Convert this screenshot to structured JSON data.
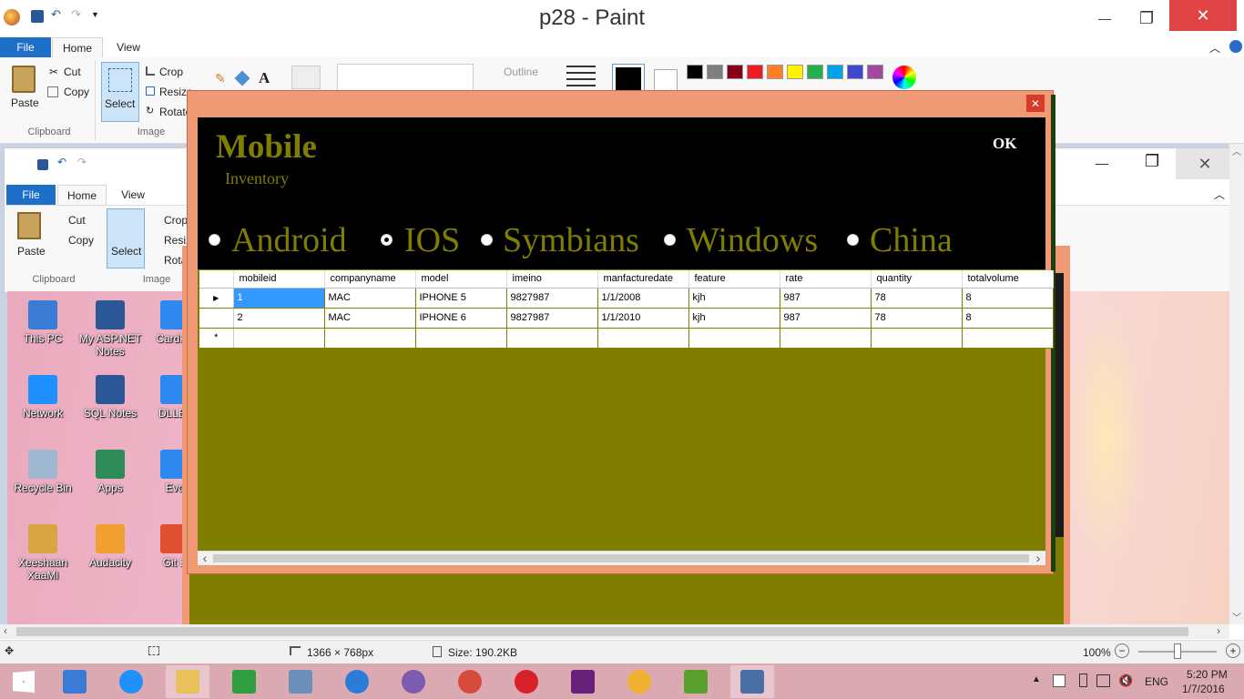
{
  "window": {
    "title": "p28 - Paint",
    "minimize": "—",
    "maximize": "❐",
    "close": "✕"
  },
  "ribbon": {
    "file_tab": "File",
    "home_tab": "Home",
    "view_tab": "View",
    "paste": "Paste",
    "cut": "Cut",
    "copy": "Copy",
    "clipboard_group": "Clipboard",
    "select": "Select",
    "crop": "Crop",
    "resize": "Resize",
    "rotate": "Rotate",
    "image_group": "Image",
    "outline": "Outline",
    "colors": [
      "#000000",
      "#7f7f7f",
      "#880015",
      "#ed1c24",
      "#ff7f27",
      "#fff200",
      "#22b14c",
      "#00a2e8",
      "#3f48cc",
      "#a349a4"
    ]
  },
  "inner_window": {
    "file_tab": "File",
    "home_tab": "Home",
    "view_tab": "View",
    "paste": "Paste",
    "cut": "Cut",
    "copy": "Copy",
    "clipboard_group": "Clipboard",
    "select": "Select",
    "crop": "Crop",
    "resize": "Resiz",
    "rotate": "Rota",
    "image_group": "Image"
  },
  "desktop_icons": [
    {
      "label": "This PC",
      "color": "#3a7bd5"
    },
    {
      "label": "My ASP.NET Notes",
      "color": "#2b5797"
    },
    {
      "label": "CardRe",
      "color": "#2d89ef"
    },
    {
      "label": "Network",
      "color": "#1e90ff"
    },
    {
      "label": "SQL Notes",
      "color": "#2b5797"
    },
    {
      "label": "DLLEs",
      "color": "#2d89ef"
    },
    {
      "label": "Recycle Bin",
      "color": "#9fb7d0"
    },
    {
      "label": "Apps",
      "color": "#2e8b57"
    },
    {
      "label": "Evo",
      "color": "#2d89ef"
    },
    {
      "label": "Xeeshaan XaaMi",
      "color": "#d9a441"
    },
    {
      "label": "Audacity",
      "color": "#f0a030"
    },
    {
      "label": "Git B",
      "color": "#e05030"
    }
  ],
  "dialog": {
    "close": "✕",
    "title": "Mobile",
    "subtitle": "Inventory",
    "ok": "OK",
    "radios": [
      {
        "label": "Android",
        "selected": false
      },
      {
        "label": "IOS",
        "selected": true
      },
      {
        "label": "Symbians",
        "selected": false
      },
      {
        "label": "Windows",
        "selected": false
      },
      {
        "label": "China",
        "selected": false
      }
    ],
    "columns": [
      "mobileid",
      "companyname",
      "model",
      "imeino",
      "manfacturedate",
      "feature",
      "rate",
      "quantity",
      "totalvolume"
    ],
    "rows": [
      [
        "1",
        "MAC",
        "IPHONE 5",
        "9827987",
        "1/1/2008",
        "kjh",
        "987",
        "78",
        "8"
      ],
      [
        "2",
        "MAC",
        "IPHONE 6",
        "9827987",
        "1/1/2010",
        "kjh",
        "987",
        "78",
        "8"
      ]
    ],
    "current_row_marker": "▶",
    "new_row_marker": "*",
    "scroll_left": "‹",
    "scroll_right": "›"
  },
  "statusbar": {
    "dimensions": "1366 × 768px",
    "size": "Size: 190.2KB",
    "zoom": "100%",
    "zoom_out": "−",
    "zoom_in": "+",
    "zoom_level": 1.0
  },
  "taskbar": {
    "language": "ENG",
    "time": "5:20 PM",
    "date": "1/7/2016"
  }
}
